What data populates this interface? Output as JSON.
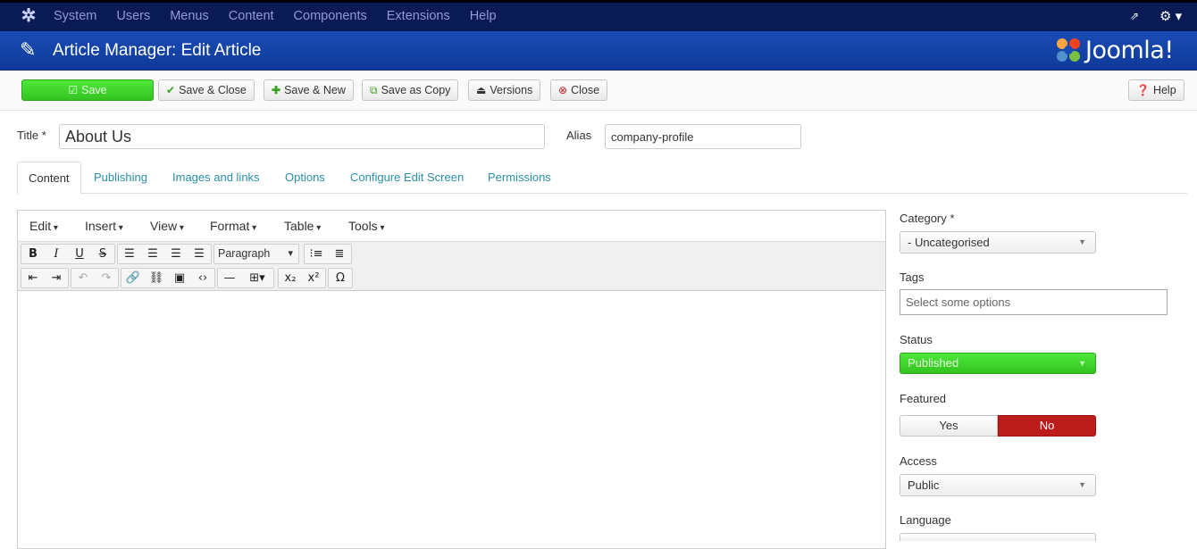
{
  "topnav": {
    "menu": [
      "System",
      "Users",
      "Menus",
      "Content",
      "Components",
      "Extensions",
      "Help"
    ]
  },
  "header": {
    "title": "Article Manager: Edit Article",
    "brand": "Joomla!"
  },
  "toolbar": {
    "save": "Save",
    "save_close": "Save & Close",
    "save_new": "Save & New",
    "save_copy": "Save as Copy",
    "versions": "Versions",
    "close": "Close",
    "help": "Help"
  },
  "form": {
    "title_label": "Title *",
    "title_value": "About Us",
    "alias_label": "Alias",
    "alias_value": "company-profile"
  },
  "tabs": [
    "Content",
    "Publishing",
    "Images and links",
    "Options",
    "Configure Edit Screen",
    "Permissions"
  ],
  "editor": {
    "menus": [
      "Edit",
      "Insert",
      "View",
      "Format",
      "Table",
      "Tools"
    ],
    "block_format": "Paragraph"
  },
  "sidebar": {
    "category_label": "Category *",
    "category_value": "- Uncategorised",
    "tags_label": "Tags",
    "tags_placeholder": "Select some options",
    "status_label": "Status",
    "status_value": "Published",
    "featured_label": "Featured",
    "featured_yes": "Yes",
    "featured_no": "No",
    "access_label": "Access",
    "access_value": "Public",
    "language_label": "Language"
  },
  "colors": {
    "nav_bg": "#0a1a55",
    "header_bg": "#1a4cb5",
    "save_green": "#3fd42b",
    "toggle_red": "#bd1c1c",
    "tab_link": "#2a8fa8"
  }
}
